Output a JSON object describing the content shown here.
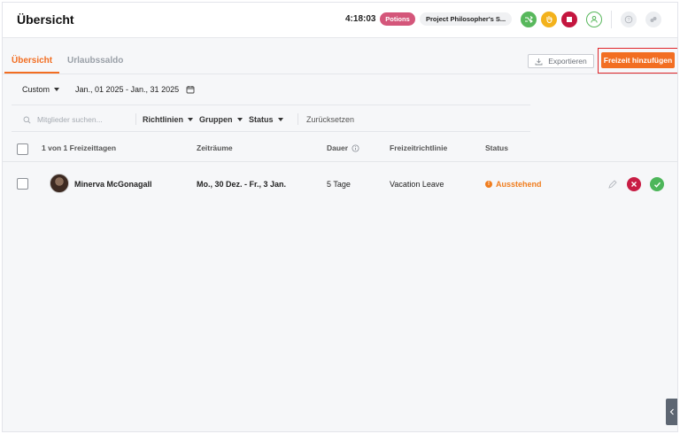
{
  "header": {
    "title": "Übersicht",
    "timer": "4:18:03",
    "tag": "Potions",
    "project": "Project Philosopher's S..."
  },
  "tabs": [
    {
      "label": "Übersicht",
      "active": true
    },
    {
      "label": "Urlaubssaldo",
      "active": false
    }
  ],
  "toolbar": {
    "export_label": "Exportieren",
    "add_label": "Freizeit hinzufügen"
  },
  "date_filter": {
    "period": "Custom",
    "range": "Jan., 01 2025 - Jan., 31 2025"
  },
  "filters": {
    "search_placeholder": "Mitglieder suchen...",
    "policies": "Richtlinien",
    "groups": "Gruppen",
    "status": "Status",
    "reset": "Zurücksetzen"
  },
  "table": {
    "headers": {
      "count": "1 von 1 Freizeittagen",
      "periods": "Zeiträume",
      "duration": "Dauer",
      "policy": "Freizeitrichtlinie",
      "status": "Status"
    },
    "rows": [
      {
        "member": "Minerva McGonagall",
        "period": "Mo., 30 Dez. - Fr., 3 Jan.",
        "duration": "5 Tage",
        "policy": "Vacation Leave",
        "status": "Ausstehend"
      }
    ]
  },
  "colors": {
    "accent": "#f26e22",
    "pending": "#f07d1e",
    "reject": "#c81d44",
    "approve": "#4db65a"
  }
}
